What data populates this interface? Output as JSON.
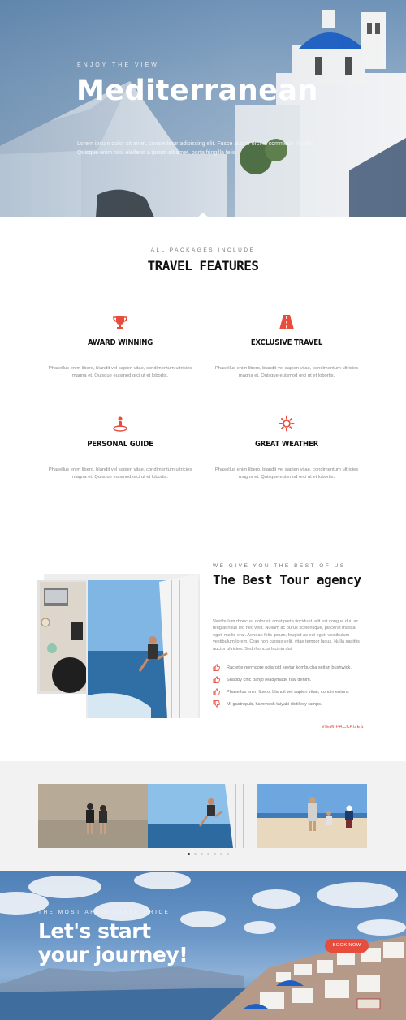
{
  "hero": {
    "eyebrow": "ENJOY THE VIEW",
    "title": "Mediterranean",
    "subtitle": "Lorem ipsum dolor sit amet, consectetur adipiscing elit. Fusce auctor orci ut commodo fringilla. Quisque enim nisi, eleifend a ipsum sit amet, porta fringilla felis."
  },
  "features": {
    "eyebrow": "ALL PACKAGES INCLUDE",
    "title": "TRAVEL FEATURES",
    "items": [
      {
        "icon": "trophy-icon",
        "name": "AWARD WINNING",
        "desc": "Phasellus enim libero, blandit vel sapien vitae, condimentum ultricies magna et. Quisque euismod orci ut et lobortis."
      },
      {
        "icon": "road-icon",
        "name": "EXCLUSIVE TRAVEL",
        "desc": "Phasellus enim libero, blandit vel sapien vitae, condimentum ultricies magna et. Quisque euismod orci ut et lobortis."
      },
      {
        "icon": "person-pin-icon",
        "name": "PERSONAL GUIDE",
        "desc": "Phasellus enim libero, blandit vel sapien vitae, condimentum ultricies magna et. Quisque euismod orci ut et lobortis."
      },
      {
        "icon": "sun-icon",
        "name": "GREAT WEATHER",
        "desc": "Phasellus enim libero, blandit vel sapien vitae, condimentum ultricies magna et. Quisque euismod orci ut et lobortis."
      }
    ]
  },
  "agency": {
    "eyebrow": "WE GIVE YOU THE BEST OF US",
    "title": "The Best Tour agency",
    "text": "Vestibulum rhoncus, dolor sit amet porta tincidunt, elit est congue dui, ac feugiat risus leo nec velit. Nullam ac purus scelerisque, placerat massa eget, mollis erat. Aenean felis ipsum, feugiat ac est eget, vestibulum vestibulum lorem. Cras non cursus velit, vitae tempor lacus. Nulla sagittis auctor ultricies. Sed rhoncus lacinia dui.",
    "checklist": [
      {
        "icon": "thumbs-up-icon",
        "text": "Raclette normcore polaroid keytar kombucha seitan bushwick."
      },
      {
        "icon": "thumbs-up-icon",
        "text": "Shabby chic banjo readymade raw denim."
      },
      {
        "icon": "thumbs-up-icon",
        "text": "Phasellus enim libero, blandit vel sapien vitae, condimentum."
      },
      {
        "icon": "thumbs-down-icon",
        "text": "Mi gastropub, hammock taiyaki distillery ramps."
      }
    ],
    "link": "VIEW PACKAGES"
  },
  "gallery": {
    "slide_count": 7,
    "active_slide": 1
  },
  "cta": {
    "eyebrow": "THE MOST AFFORDABLE PRICE",
    "title_line1": "Let's start",
    "title_line2": "your journey!",
    "button": "BOOK NOW"
  },
  "colors": {
    "accent": "#e74c3c",
    "heading": "#111111",
    "muted": "#888888",
    "band": "#f2f2f2"
  }
}
